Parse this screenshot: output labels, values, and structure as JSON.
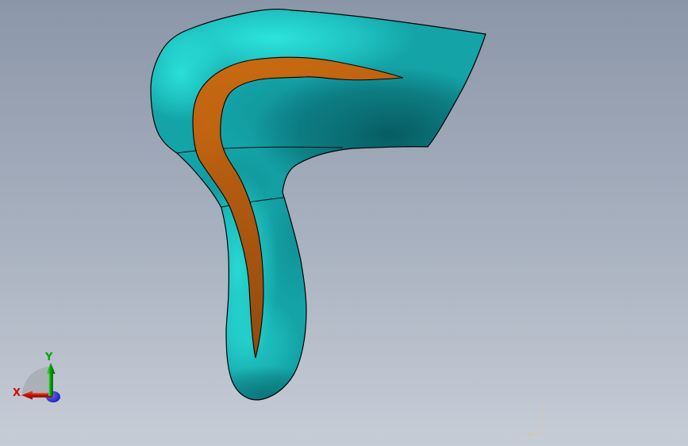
{
  "viewport": {
    "kind": "3d-cad-viewport",
    "background_top": "#8B96A8",
    "background_mid": "#A9B2C0",
    "background_bottom": "#C7CDD7"
  },
  "model": {
    "name": "lofted-surface-part",
    "surface_highlight": "#2FEDE4",
    "surface_mid": "#14A4A8",
    "surface_dark": "#03474E",
    "surface_middark": "#0B7880",
    "stripe_light": "#C96A12",
    "stripe_mid": "#B05A10",
    "stripe_dark": "#8F4A10",
    "edge_color": "#000000"
  },
  "triad": {
    "x_label": "X",
    "y_label": "Y",
    "x_color": "#CC1100",
    "x_color_dark": "#7A0E00",
    "y_color": "#00A800",
    "y_color_dark": "#005800",
    "z_color": "#2020B8",
    "arc_color": "#9AA0A6"
  },
  "origin_marker": {
    "color": "#CFC9AF"
  }
}
